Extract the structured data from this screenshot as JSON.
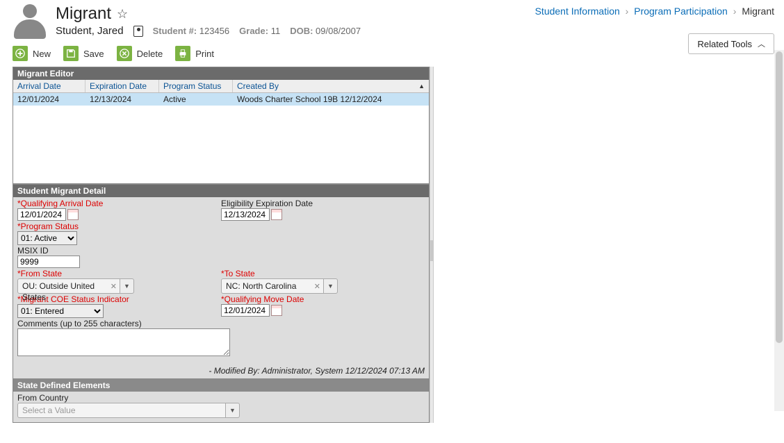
{
  "header": {
    "title": "Migrant",
    "student_name": "Student, Jared",
    "student_num_label": "Student #:",
    "student_num": "123456",
    "grade_label": "Grade:",
    "grade": "11",
    "dob_label": "DOB:",
    "dob": "09/08/2007"
  },
  "breadcrumb": {
    "items": [
      "Student Information",
      "Program Participation"
    ],
    "current": "Migrant"
  },
  "related_tools_label": "Related Tools",
  "toolbar": {
    "new_label": "New",
    "save_label": "Save",
    "delete_label": "Delete",
    "print_label": "Print"
  },
  "editor": {
    "title": "Migrant Editor",
    "cols": {
      "arrival": "Arrival Date",
      "expiration": "Expiration Date",
      "status": "Program Status",
      "created": "Created By"
    },
    "rows": [
      {
        "arrival": "12/01/2024",
        "expiration": "12/13/2024",
        "status": "Active",
        "created": "Woods Charter School 19B 12/12/2024"
      }
    ]
  },
  "detail": {
    "title": "Student Migrant Detail",
    "qual_arrival_label": "*Qualifying Arrival Date",
    "qual_arrival": "12/01/2024",
    "elig_exp_label": "Eligibility Expiration Date",
    "elig_exp": "12/13/2024",
    "prog_status_label": "*Program Status",
    "prog_status": "01: Active",
    "msix_label": "MSIX ID",
    "msix": "9999",
    "from_state_label": "*From State",
    "from_state": "OU: Outside United States",
    "to_state_label": "*To State",
    "to_state": "NC: North Carolina",
    "coe_label": "*Migrant COE Status Indicator",
    "coe": "01: Entered",
    "qual_move_label": "*Qualifying Move Date",
    "qual_move": "12/01/2024",
    "comments_label": "Comments (up to 255 characters)",
    "modified_by": "- Modified By: Administrator, System 12/12/2024 07:13 AM"
  },
  "state_elements": {
    "title": "State Defined Elements",
    "from_country_label": "From Country",
    "from_country_placeholder": "Select a Value"
  }
}
